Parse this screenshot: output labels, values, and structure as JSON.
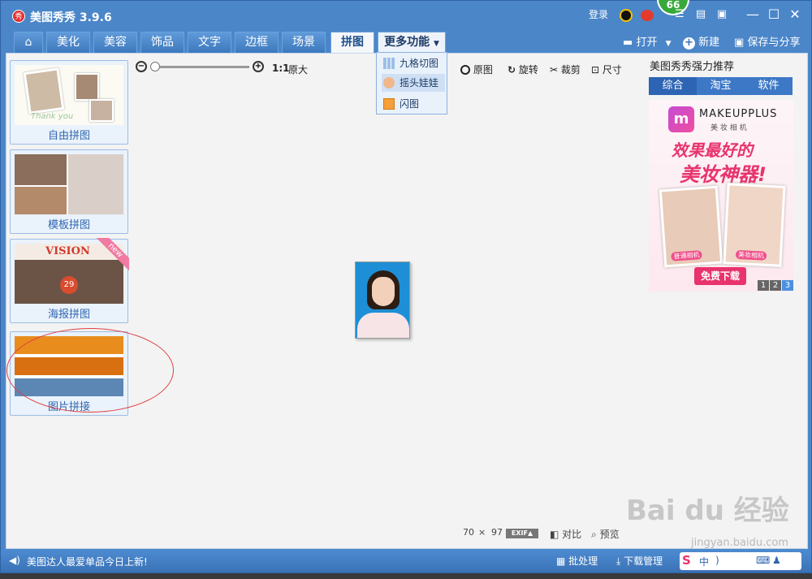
{
  "app": {
    "title": "美图秀秀 3.9.6",
    "login": "登录",
    "badge": "66"
  },
  "tabs": [
    {
      "label": "美化"
    },
    {
      "label": "美容"
    },
    {
      "label": "饰品"
    },
    {
      "label": "文字"
    },
    {
      "label": "边框"
    },
    {
      "label": "场景"
    },
    {
      "label": "拼图"
    },
    {
      "label": "更多功能"
    }
  ],
  "toolbar_right": {
    "open": "打开",
    "new": "新建",
    "save": "保存与分享"
  },
  "dropdown": {
    "items": [
      {
        "label": "九格切图"
      },
      {
        "label": "摇头娃娃"
      },
      {
        "label": "闪图"
      }
    ]
  },
  "left_panel": {
    "items": [
      {
        "label": "自由拼图",
        "thumb_text": "Thank you"
      },
      {
        "label": "模板拼图"
      },
      {
        "label": "海报拼图",
        "thumb_text": "VISION",
        "ribbon": "new",
        "number": "29"
      },
      {
        "label": "图片拼接"
      }
    ]
  },
  "zoom": {
    "ratio": "1:1",
    "original_size": "原大"
  },
  "image_tools": {
    "original": "原图",
    "rotate": "旋转",
    "crop": "裁剪",
    "size": "尺寸"
  },
  "promo": {
    "title": "美图秀秀强力推荐",
    "tabs": [
      "综合",
      "淘宝",
      "软件"
    ],
    "active_tab": 0,
    "brand": "MAKEUPPLUS",
    "brand_sub": "美 妆 相 机",
    "headline1": "效果最好的",
    "headline2": "美妆神器!",
    "caption_left": "普通相机",
    "caption_right": "美妆相机",
    "download": "免费下载",
    "pages": [
      "1",
      "2",
      "3"
    ],
    "active_page": 2
  },
  "canvas_info": {
    "width": "70",
    "times": "×",
    "height": "97",
    "exif": "EXIF▲",
    "compare": "对比",
    "preview": "预览"
  },
  "status": {
    "message": "美图达人最爱单品今日上新!",
    "batch": "批处理",
    "download_mgr": "下载管理"
  },
  "watermark": {
    "text": "Bai du 经验",
    "url": "jingyan.baidu.com"
  },
  "colors": {
    "title_blue": "#4b86c9",
    "accent_pink": "#e8336d",
    "label_blue": "#2f66b0"
  }
}
